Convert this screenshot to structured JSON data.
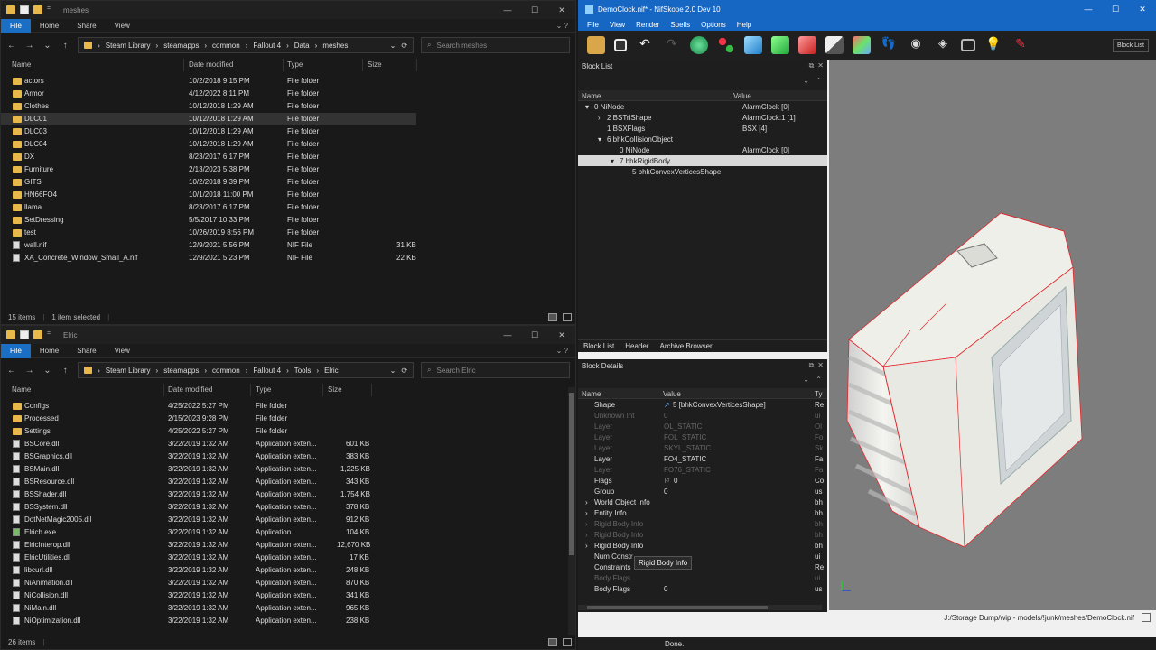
{
  "top_explorer": {
    "title": "meshes",
    "ribbon": [
      "File",
      "Home",
      "Share",
      "View"
    ],
    "path": [
      "Steam Library",
      "steamapps",
      "common",
      "Fallout 4",
      "Data",
      "meshes"
    ],
    "search_placeholder": "Search meshes",
    "columns": {
      "name": "Name",
      "date": "Date modified",
      "type": "Type",
      "size": "Size"
    },
    "items": [
      {
        "name": "actors",
        "date": "10/2/2018 9:15 PM",
        "type": "File folder",
        "size": ""
      },
      {
        "name": "Armor",
        "date": "4/12/2022 8:11 PM",
        "type": "File folder",
        "size": ""
      },
      {
        "name": "Clothes",
        "date": "10/12/2018 1:29 AM",
        "type": "File folder",
        "size": ""
      },
      {
        "name": "DLC01",
        "date": "10/12/2018 1:29 AM",
        "type": "File folder",
        "size": ""
      },
      {
        "name": "DLC03",
        "date": "10/12/2018 1:29 AM",
        "type": "File folder",
        "size": ""
      },
      {
        "name": "DLC04",
        "date": "10/12/2018 1:29 AM",
        "type": "File folder",
        "size": ""
      },
      {
        "name": "DX",
        "date": "8/23/2017 6:17 PM",
        "type": "File folder",
        "size": ""
      },
      {
        "name": "Furniture",
        "date": "2/13/2023 5:38 PM",
        "type": "File folder",
        "size": ""
      },
      {
        "name": "GITS",
        "date": "10/2/2018 9:39 PM",
        "type": "File folder",
        "size": ""
      },
      {
        "name": "HN66FO4",
        "date": "10/1/2018 11:00 PM",
        "type": "File folder",
        "size": ""
      },
      {
        "name": "llama",
        "date": "8/23/2017 6:17 PM",
        "type": "File folder",
        "size": ""
      },
      {
        "name": "SetDressing",
        "date": "5/5/2017 10:33 PM",
        "type": "File folder",
        "size": ""
      },
      {
        "name": "test",
        "date": "10/26/2019 8:56 PM",
        "type": "File folder",
        "size": ""
      },
      {
        "name": "wall.nif",
        "date": "12/9/2021 5:56 PM",
        "type": "NIF File",
        "size": "31 KB"
      },
      {
        "name": "XA_Concrete_Window_Small_A.nif",
        "date": "12/9/2021 5:23 PM",
        "type": "NIF File",
        "size": "22 KB"
      }
    ],
    "status_count": "15 items",
    "status_selected": "1 item selected"
  },
  "bottom_explorer": {
    "title": "Elric",
    "ribbon": [
      "File",
      "Home",
      "Share",
      "View"
    ],
    "path": [
      "Steam Library",
      "steamapps",
      "common",
      "Fallout 4",
      "Tools",
      "Elric"
    ],
    "search_placeholder": "Search Elric",
    "columns": {
      "name": "Name",
      "date": "Date modified",
      "type": "Type",
      "size": "Size"
    },
    "items": [
      {
        "name": "Configs",
        "date": "4/25/2022 5:27 PM",
        "type": "File folder",
        "size": ""
      },
      {
        "name": "Processed",
        "date": "2/15/2023 9:28 PM",
        "type": "File folder",
        "size": ""
      },
      {
        "name": "Settings",
        "date": "4/25/2022 5:27 PM",
        "type": "File folder",
        "size": ""
      },
      {
        "name": "BSCore.dll",
        "date": "3/22/2019 1:32 AM",
        "type": "Application exten...",
        "size": "601 KB"
      },
      {
        "name": "BSGraphics.dll",
        "date": "3/22/2019 1:32 AM",
        "type": "Application exten...",
        "size": "383 KB"
      },
      {
        "name": "BSMain.dll",
        "date": "3/22/2019 1:32 AM",
        "type": "Application exten...",
        "size": "1,225 KB"
      },
      {
        "name": "BSResource.dll",
        "date": "3/22/2019 1:32 AM",
        "type": "Application exten...",
        "size": "343 KB"
      },
      {
        "name": "BSShader.dll",
        "date": "3/22/2019 1:32 AM",
        "type": "Application exten...",
        "size": "1,754 KB"
      },
      {
        "name": "BSSystem.dll",
        "date": "3/22/2019 1:32 AM",
        "type": "Application exten...",
        "size": "378 KB"
      },
      {
        "name": "DotNetMagic2005.dll",
        "date": "3/22/2019 1:32 AM",
        "type": "Application exten...",
        "size": "912 KB"
      },
      {
        "name": "Elrich.exe",
        "date": "3/22/2019 1:32 AM",
        "type": "Application",
        "size": "104 KB"
      },
      {
        "name": "ElricInterop.dll",
        "date": "3/22/2019 1:32 AM",
        "type": "Application exten...",
        "size": "12,670 KB"
      },
      {
        "name": "ElricUtilities.dll",
        "date": "3/22/2019 1:32 AM",
        "type": "Application exten...",
        "size": "17 KB"
      },
      {
        "name": "libcurl.dll",
        "date": "3/22/2019 1:32 AM",
        "type": "Application exten...",
        "size": "248 KB"
      },
      {
        "name": "NiAnimation.dll",
        "date": "3/22/2019 1:32 AM",
        "type": "Application exten...",
        "size": "870 KB"
      },
      {
        "name": "NiCollision.dll",
        "date": "3/22/2019 1:32 AM",
        "type": "Application exten...",
        "size": "341 KB"
      },
      {
        "name": "NiMain.dll",
        "date": "3/22/2019 1:32 AM",
        "type": "Application exten...",
        "size": "965 KB"
      },
      {
        "name": "NiOptimization.dll",
        "date": "3/22/2019 1:32 AM",
        "type": "Application exten...",
        "size": "238 KB"
      }
    ],
    "status_count": "26 items"
  },
  "nifskope": {
    "title": "DemoClock.nif* - NifSkope 2.0 Dev 10",
    "menu": [
      "File",
      "View",
      "Render",
      "Spells",
      "Options",
      "Help"
    ],
    "toolbar_right": "Block List",
    "block_list": {
      "title": "Block List",
      "col_name": "Name",
      "col_value": "Value",
      "rows": [
        {
          "name": "0 NiNode",
          "value": "AlarmClock [0]"
        },
        {
          "name": "2 BSTriShape",
          "value": "AlarmClock:1 [1]"
        },
        {
          "name": "1 BSXFlags",
          "value": "BSX [4]"
        },
        {
          "name": "6 bhkCollisionObject",
          "value": ""
        },
        {
          "name": "0 NiNode",
          "value": "AlarmClock [0]"
        },
        {
          "name": "7 bhkRigidBody",
          "value": ""
        },
        {
          "name": "5 bhkConvexVerticesShape",
          "value": ""
        }
      ]
    },
    "tabs": [
      "Block List",
      "Header",
      "Archive Browser"
    ],
    "block_details": {
      "title": "Block Details",
      "col_name": "Name",
      "col_value": "Value",
      "col_type": "Ty",
      "rows": [
        {
          "name": "Shape",
          "value": "5 [bhkConvexVerticesShape]",
          "type": "Re",
          "dim": false
        },
        {
          "name": "Unknown Int",
          "value": "0",
          "type": "ui",
          "dim": true
        },
        {
          "name": "Layer",
          "value": "OL_STATIC",
          "type": "Ol",
          "dim": true
        },
        {
          "name": "Layer",
          "value": "FOL_STATIC",
          "type": "Fo",
          "dim": true
        },
        {
          "name": "Layer",
          "value": "SKYL_STATIC",
          "type": "Sk",
          "dim": true
        },
        {
          "name": "Layer",
          "value": "FO4_STATIC",
          "type": "Fa",
          "dim": false
        },
        {
          "name": "Layer",
          "value": "FO76_STATIC",
          "type": "Fa",
          "dim": true
        },
        {
          "name": "Flags",
          "value": "0",
          "type": "Co",
          "dim": false
        },
        {
          "name": "Group",
          "value": "0",
          "type": "us",
          "dim": false
        },
        {
          "name": "World Object Info",
          "value": "",
          "type": "bh",
          "dim": false
        },
        {
          "name": "Entity Info",
          "value": "",
          "type": "bh",
          "dim": false
        },
        {
          "name": "Rigid Body Info",
          "value": "",
          "type": "bh",
          "dim": true
        },
        {
          "name": "Rigid Body Info",
          "value": "",
          "type": "bh",
          "dim": true
        },
        {
          "name": "Rigid Body Info",
          "value": "",
          "type": "bh",
          "dim": false
        },
        {
          "name": "Num Constr",
          "value": "",
          "type": "ui",
          "dim": false
        },
        {
          "name": "Constraints",
          "value": "",
          "type": "Re",
          "dim": false
        },
        {
          "name": "Body Flags",
          "value": "",
          "type": "ui",
          "dim": true
        },
        {
          "name": "Body Flags",
          "value": "0",
          "type": "us",
          "dim": false
        }
      ],
      "tooltip": "Rigid Body Info"
    },
    "file_path": "J:/Storage Dump/wip - models/!junk/meshes/DemoClock.nif",
    "status": "Done."
  },
  "colors": {
    "accent": "#1666c4",
    "folder": "#e8b84a",
    "wire": "#e3262b"
  }
}
